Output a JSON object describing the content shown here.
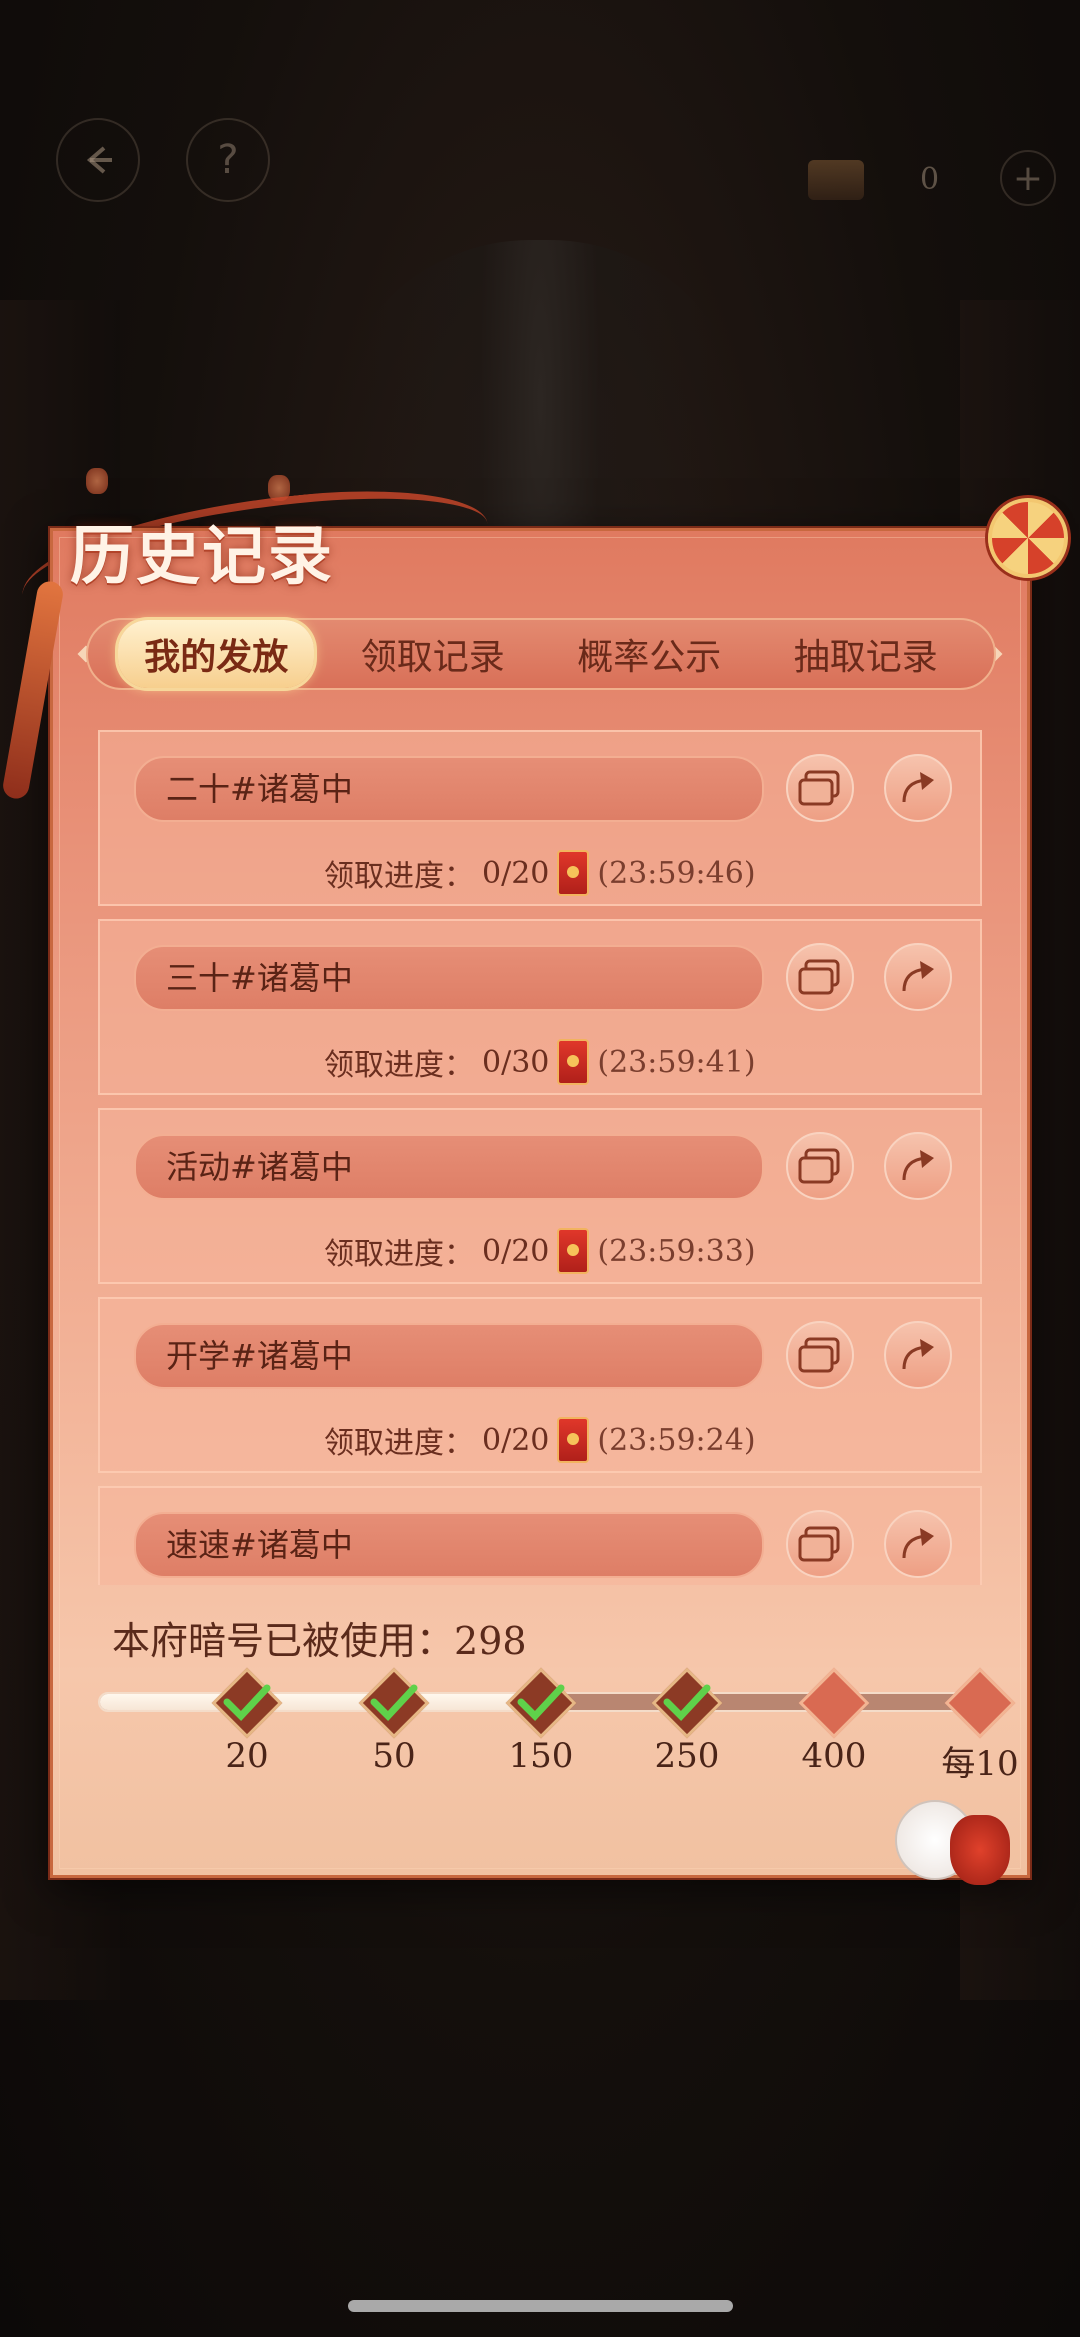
{
  "topbar": {
    "back_icon": "arrow-left-icon",
    "help_label": "?",
    "currency_value": "0",
    "plus_label": "+"
  },
  "panel": {
    "title": "历史记录"
  },
  "tabs": [
    {
      "label": "我的发放",
      "active": true
    },
    {
      "label": "领取记录",
      "active": false
    },
    {
      "label": "概率公示",
      "active": false
    },
    {
      "label": "抽取记录",
      "active": false
    }
  ],
  "records": [
    {
      "code": "二十#诸葛中",
      "progress_label": "领取进度：",
      "progress": "0/20",
      "timer": "(23:59:46)"
    },
    {
      "code": "三十#诸葛中",
      "progress_label": "领取进度：",
      "progress": "0/30",
      "timer": "(23:59:41)"
    },
    {
      "code": "活动#诸葛中",
      "progress_label": "领取进度：",
      "progress": "0/20",
      "timer": "(23:59:33)"
    },
    {
      "code": "开学#诸葛中",
      "progress_label": "领取进度：",
      "progress": "0/20",
      "timer": "(23:59:24)"
    },
    {
      "code": "速速#诸葛中",
      "progress_label": "",
      "progress": "",
      "timer": ""
    }
  ],
  "usage": {
    "label": "本府暗号已被使用：",
    "value": "298"
  },
  "milestones": [
    {
      "label": "20",
      "reached": true
    },
    {
      "label": "50",
      "reached": true
    },
    {
      "label": "150",
      "reached": true
    },
    {
      "label": "250",
      "reached": true
    },
    {
      "label": "400",
      "reached": false
    },
    {
      "label": "每10",
      "reached": false
    }
  ],
  "milestone_progress_fraction": 0.48,
  "colors": {
    "accent": "#d6412a",
    "panel": "#e9937a",
    "check": "#5fd14a"
  }
}
